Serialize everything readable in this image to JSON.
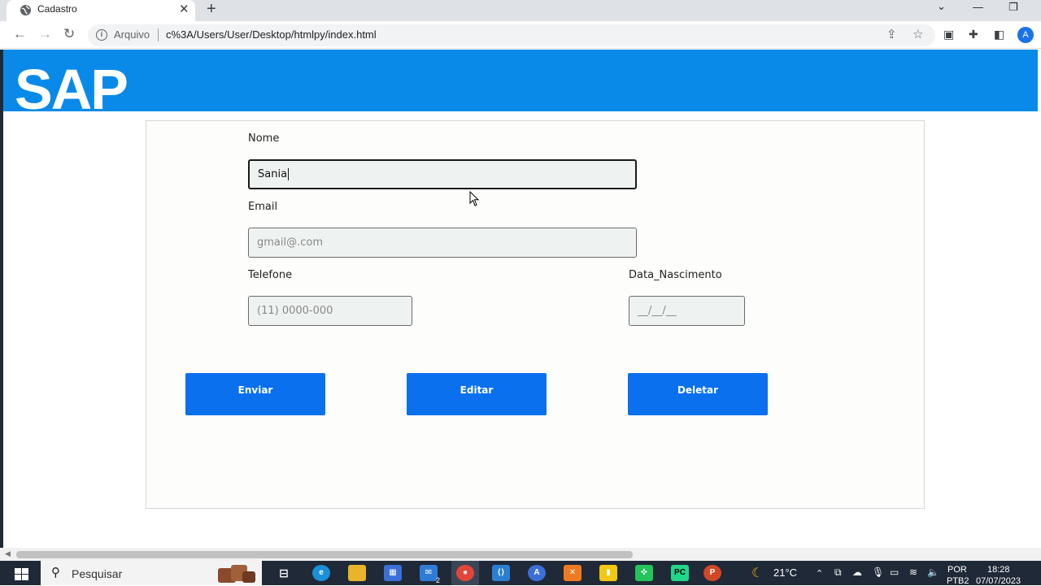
{
  "browser": {
    "tab_title": "Cadastro",
    "tab_close": "✕",
    "new_tab": "+",
    "url_prefix": "Arquivo",
    "url": "c%3A/Users/User/Desktop/htmlpy/index.html",
    "profile_initial": "A"
  },
  "page": {
    "logo_text": "SAP",
    "form": {
      "nome_label": "Nome",
      "nome_value": "Sania",
      "email_label": "Email",
      "email_placeholder": "gmail@.com",
      "telefone_label": "Telefone",
      "telefone_placeholder": "(11) 0000-000",
      "nascimento_label": "Data_Nascimento",
      "nascimento_placeholder": "__/__/__",
      "enviar_label": "Enviar",
      "editar_label": "Editar",
      "deletar_label": "Deletar"
    }
  },
  "taskbar": {
    "search_placeholder": "Pesquisar",
    "weather": "21°C",
    "language_top": "POR",
    "language_bottom": "PTB2",
    "time": "18:28",
    "date": "07/07/2023",
    "mail_badge": "2"
  },
  "colors": {
    "banner": "#0a8ae8",
    "button": "#0a70ee",
    "taskbar": "#1f2937"
  }
}
